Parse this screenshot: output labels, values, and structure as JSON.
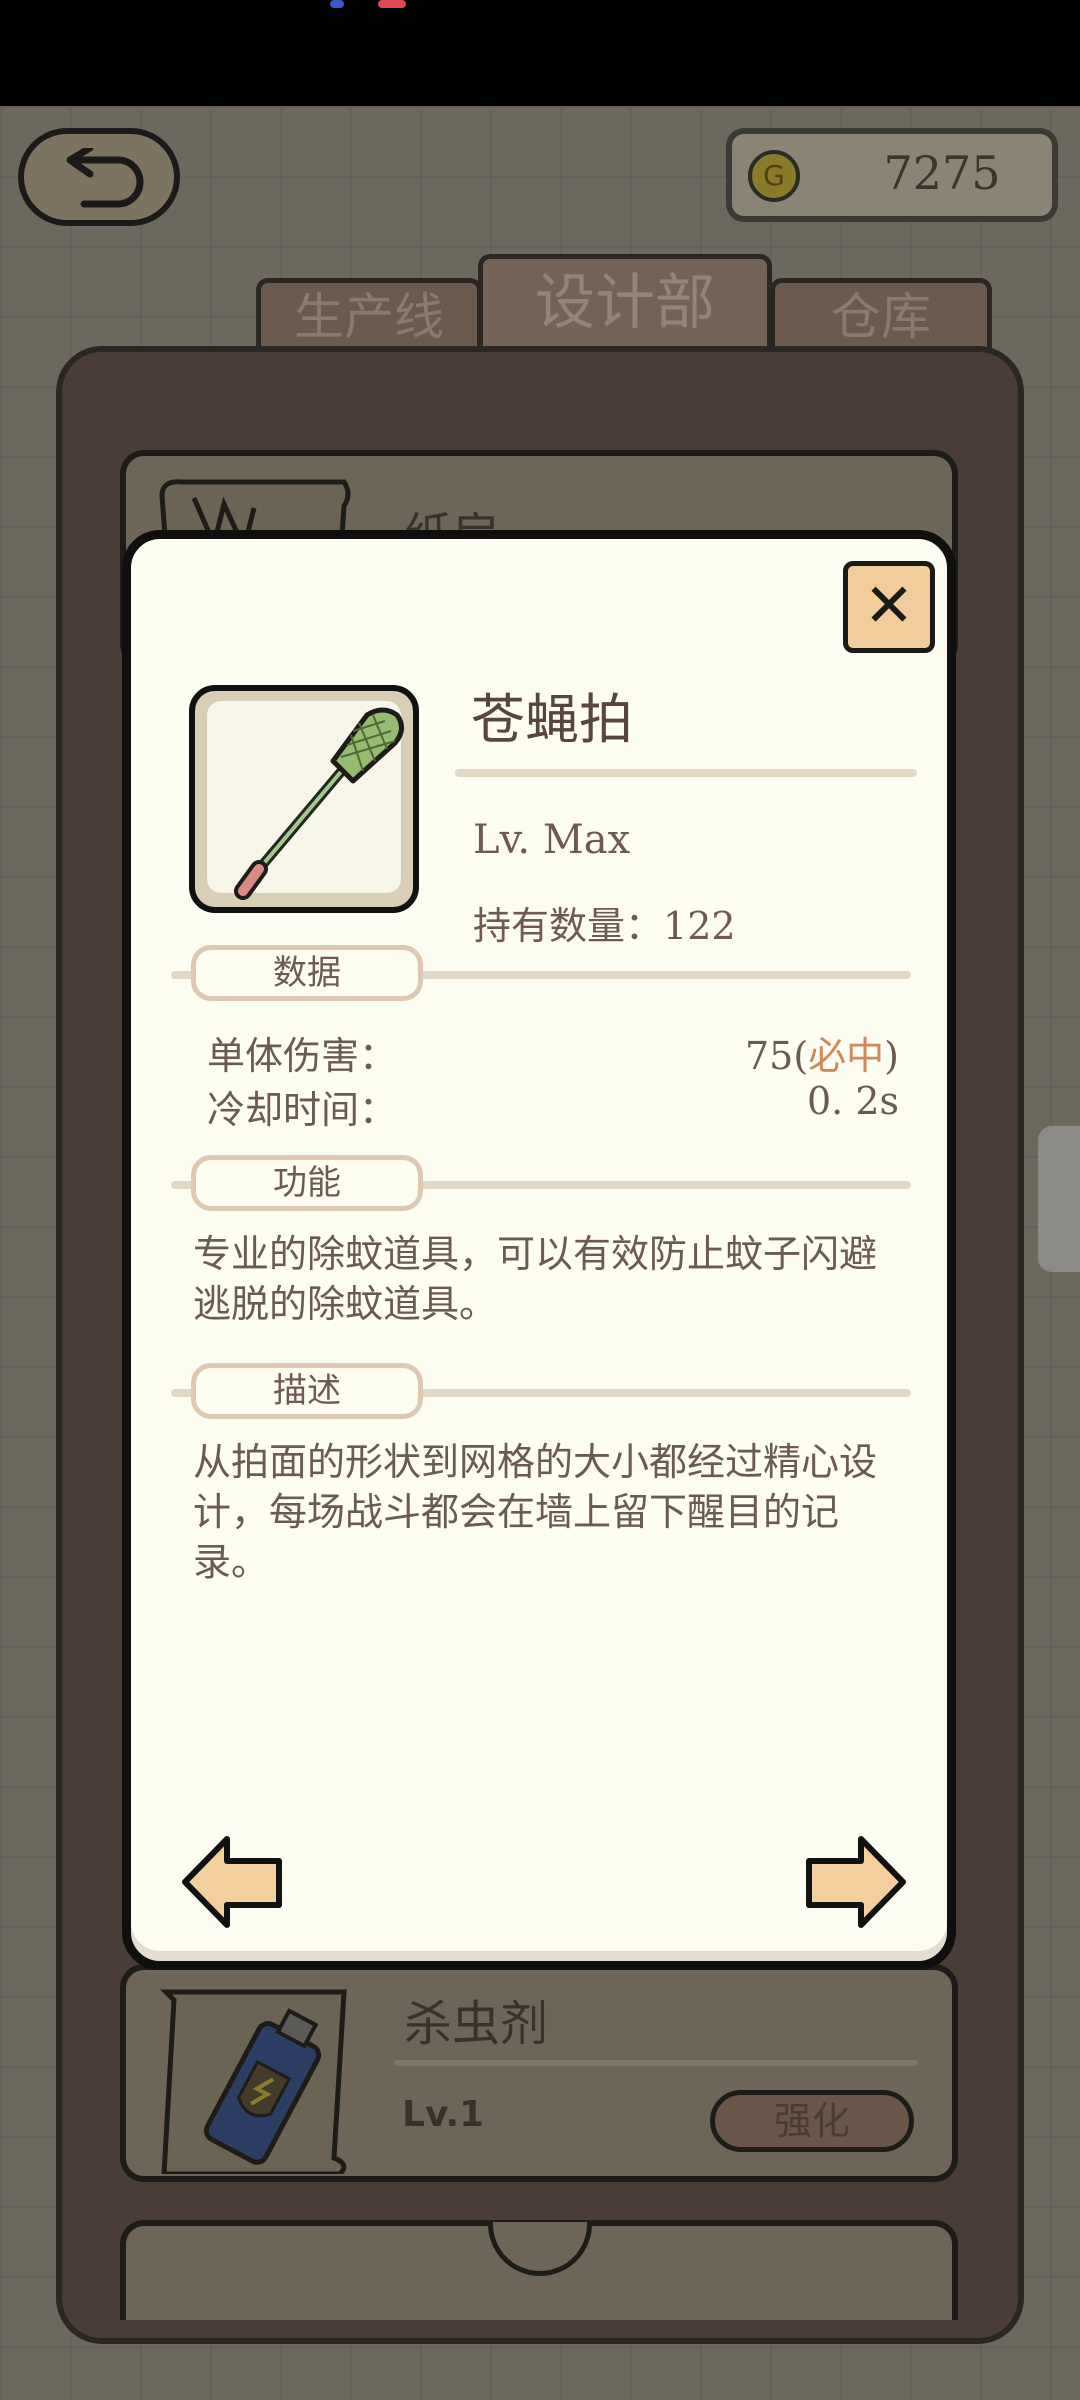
{
  "statusbar": {},
  "header": {
    "back_icon": "undo-arrow-icon",
    "coin_icon_letter": "G",
    "coins": "7275"
  },
  "tabs": [
    {
      "label": "生产线",
      "active": false
    },
    {
      "label": "设计部",
      "active": true
    },
    {
      "label": "仓库",
      "active": false
    }
  ],
  "list": {
    "top_item_name": "纸扇",
    "bottom_item": {
      "name": "杀虫剂",
      "level": "Lv.1",
      "upgrade_label": "强化"
    }
  },
  "modal": {
    "close_label": "✕",
    "item": {
      "name": "苍蝇拍",
      "level": "Lv. Max",
      "count_label": "持有数量：",
      "count": "122"
    },
    "data_section": {
      "title": "数据",
      "rows": [
        {
          "label": "单体伤害：",
          "value": "75",
          "suffix_open": "(",
          "highlight": "必中",
          "suffix_close": ")"
        },
        {
          "label": "冷却时间：",
          "value": "0. 2s"
        }
      ]
    },
    "function_section": {
      "title": "功能",
      "text": "专业的除蚊道具，可以有效防止蚊子闪避逃脱的除蚊道具。"
    },
    "description_section": {
      "title": "描述",
      "text": "从拍面的形状到网格的大小都经过精心设计，每场战斗都会在墙上留下醒目的记录。"
    }
  },
  "colors": {
    "modal_bg": "#fdfdf1",
    "accent_highlight": "#d0885c",
    "arrow_fill": "#f3cf9d"
  }
}
